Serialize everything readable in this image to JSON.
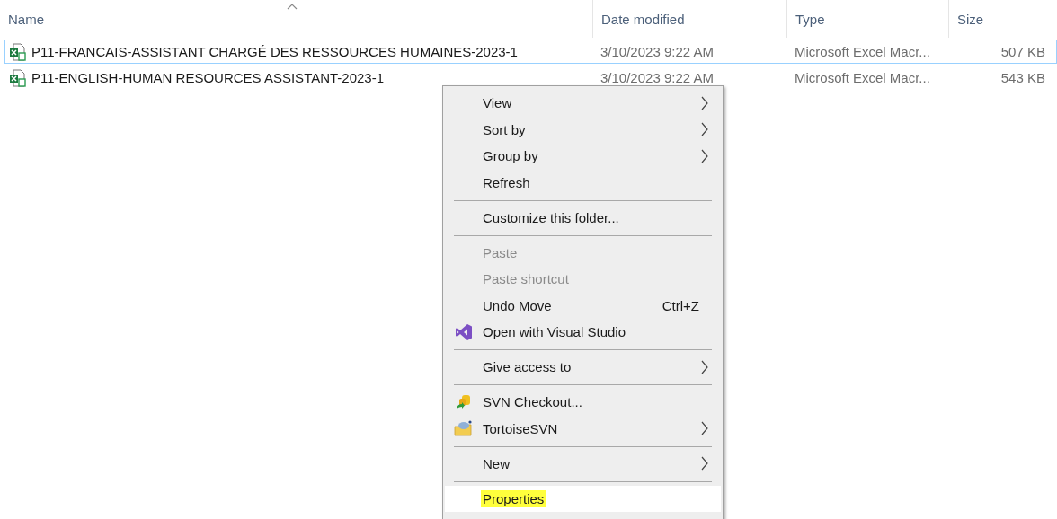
{
  "columns": [
    {
      "label": "Name",
      "sorted": true
    },
    {
      "label": "Date modified",
      "sorted": false
    },
    {
      "label": "Type",
      "sorted": false
    },
    {
      "label": "Size",
      "sorted": false
    }
  ],
  "rows": [
    {
      "name": "P11-FRANCAIS-ASSISTANT CHARGÉ DES RESSOURCES HUMAINES-2023-1",
      "date": "3/10/2023 9:22 AM",
      "type": "Microsoft Excel Macr...",
      "size": "507 KB",
      "selected": true
    },
    {
      "name": "P11-ENGLISH-HUMAN RESOURCES ASSISTANT-2023-1",
      "date": "3/10/2023 9:22 AM",
      "type": "Microsoft Excel Macr...",
      "size": "543 KB",
      "selected": false
    }
  ],
  "context_menu": [
    {
      "kind": "item",
      "label": "View",
      "submenu": true,
      "disabled": false,
      "hovered": false
    },
    {
      "kind": "item",
      "label": "Sort by",
      "submenu": true,
      "disabled": false,
      "hovered": false
    },
    {
      "kind": "item",
      "label": "Group by",
      "submenu": true,
      "disabled": false,
      "hovered": false
    },
    {
      "kind": "item",
      "label": "Refresh",
      "submenu": false,
      "disabled": false,
      "hovered": false
    },
    {
      "kind": "separator"
    },
    {
      "kind": "item",
      "label": "Customize this folder...",
      "submenu": false,
      "disabled": false,
      "hovered": false
    },
    {
      "kind": "separator"
    },
    {
      "kind": "item",
      "label": "Paste",
      "submenu": false,
      "disabled": true,
      "hovered": false
    },
    {
      "kind": "item",
      "label": "Paste shortcut",
      "submenu": false,
      "disabled": true,
      "hovered": false
    },
    {
      "kind": "item",
      "label": "Undo Move",
      "shortcut": "Ctrl+Z",
      "submenu": false,
      "disabled": false,
      "hovered": false
    },
    {
      "kind": "item",
      "label": "Open with Visual Studio",
      "submenu": false,
      "disabled": false,
      "hovered": false
    },
    {
      "kind": "separator"
    },
    {
      "kind": "item",
      "label": "Give access to",
      "submenu": true,
      "disabled": false,
      "hovered": false
    },
    {
      "kind": "separator"
    },
    {
      "kind": "item",
      "label": "SVN Checkout...",
      "submenu": false,
      "disabled": false,
      "hovered": false
    },
    {
      "kind": "item",
      "label": "TortoiseSVN",
      "submenu": true,
      "disabled": false,
      "hovered": false
    },
    {
      "kind": "separator"
    },
    {
      "kind": "item",
      "label": "New",
      "submenu": true,
      "disabled": false,
      "hovered": false
    },
    {
      "kind": "separator"
    },
    {
      "kind": "item",
      "label": "Properties",
      "submenu": false,
      "disabled": false,
      "hovered": true,
      "marked": true
    }
  ]
}
